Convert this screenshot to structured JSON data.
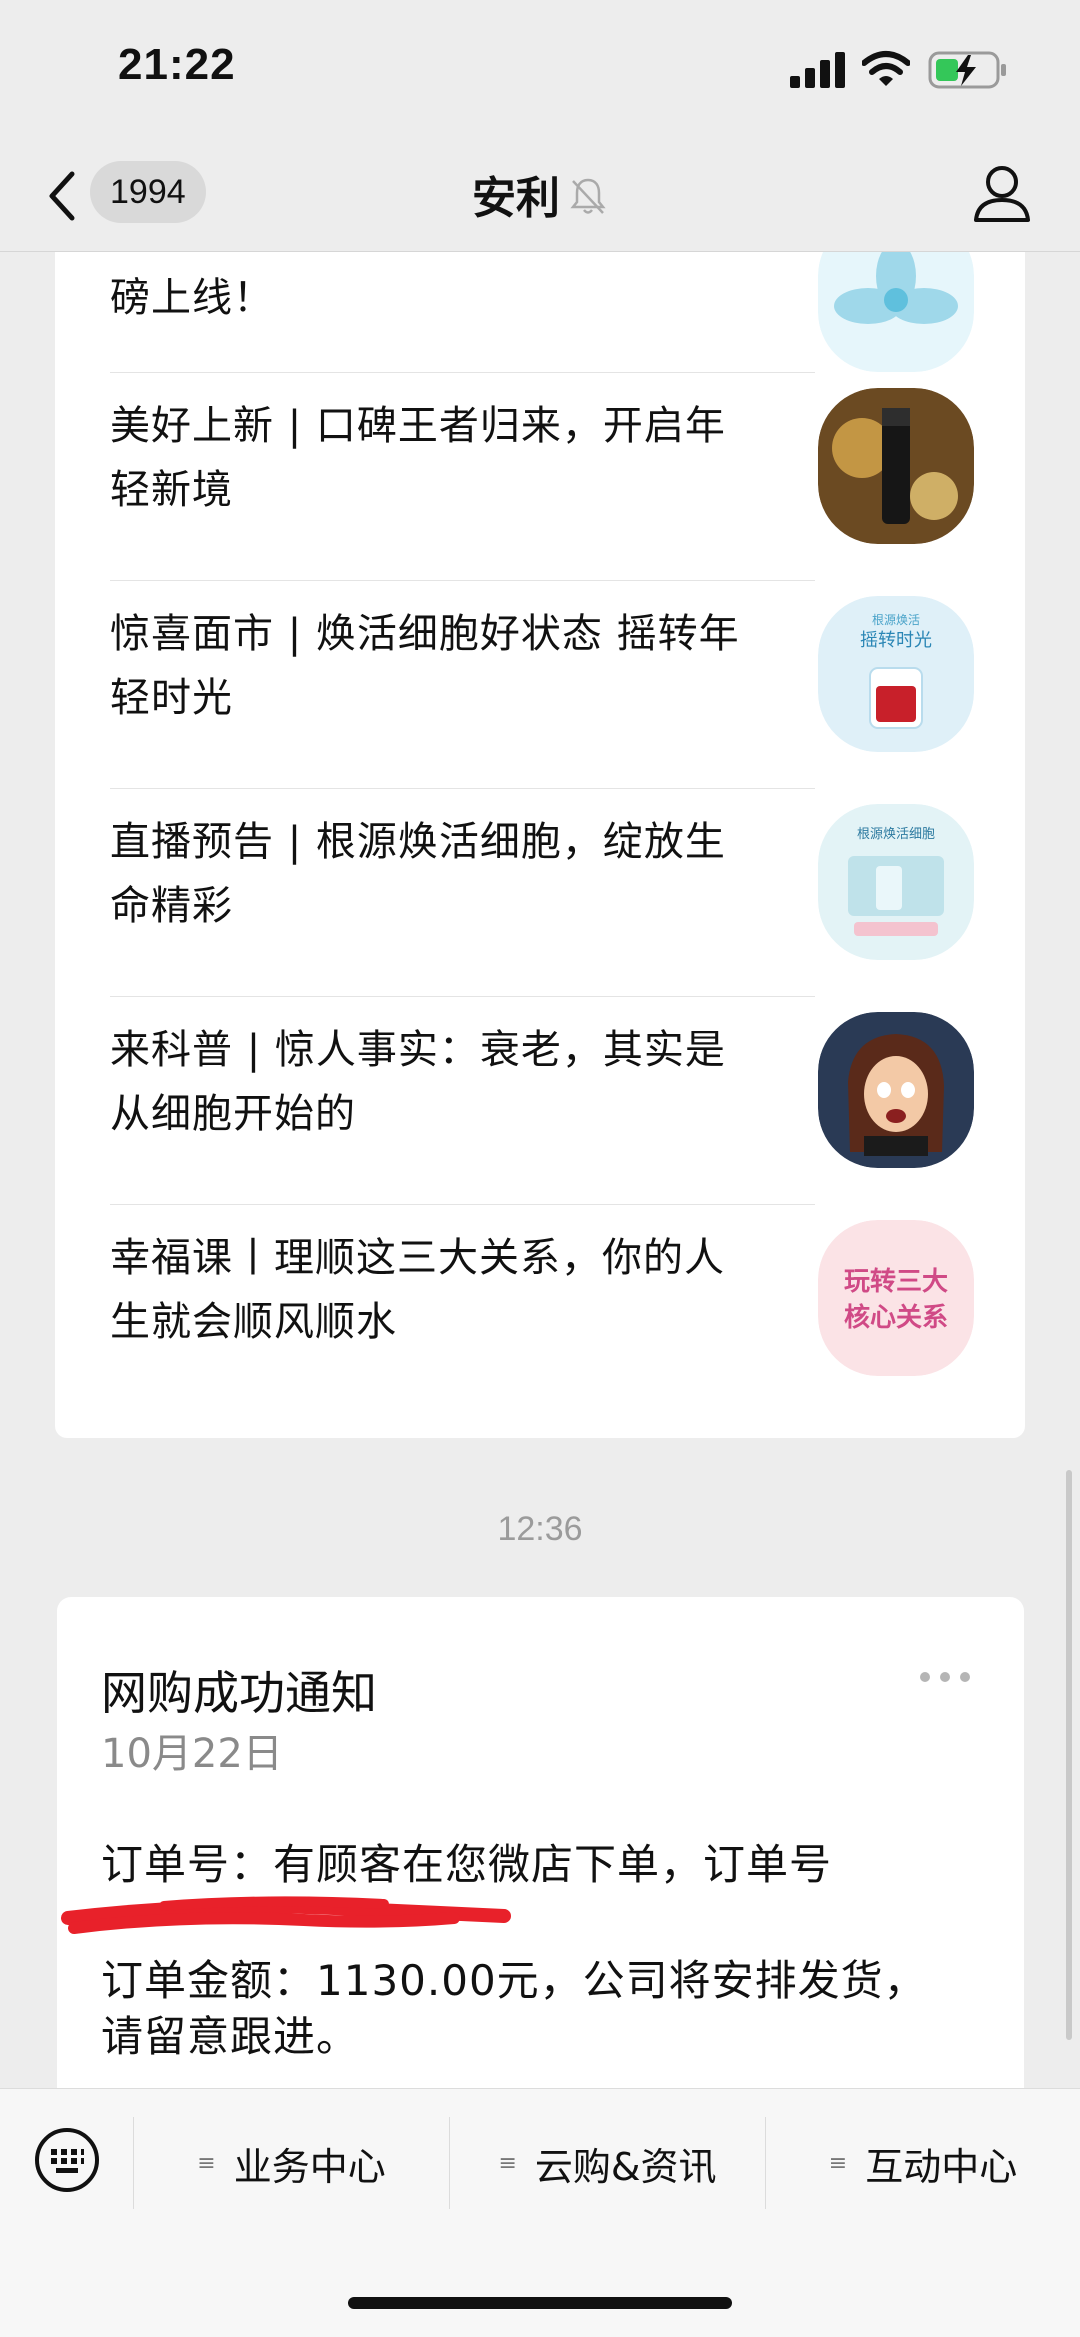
{
  "status_bar": {
    "time": "21:22",
    "icons": [
      "signal-icon",
      "wifi-icon",
      "battery-charging-icon"
    ]
  },
  "nav": {
    "unread_count": "1994",
    "title": "安利",
    "icons": [
      "back-icon",
      "mute-icon",
      "profile-icon"
    ]
  },
  "articles": [
    {
      "title": "磅上线！"
    },
    {
      "title": "美好上新 | 口碑王者归来，开启年轻新境"
    },
    {
      "title": "惊喜面市 | 焕活细胞好状态 摇转年轻时光"
    },
    {
      "title": "直播预告 | 根源焕活细胞，绽放生命精彩"
    },
    {
      "title": "来科普 | 惊人事实：衰老，其实是从细胞开始的"
    },
    {
      "title": "幸福课丨理顺这三大关系，你的人生就会顺风顺水"
    }
  ],
  "thumbnails": {
    "thumb3_text_line1": "根源焕活",
    "thumb3_text_line2": "摇转时光",
    "thumb4_text": "根源焕活细胞",
    "thumb6_line1": "玩转三大",
    "thumb6_line2": "核心关系"
  },
  "timestamp": "12:36",
  "notification": {
    "title": "网购成功通知",
    "date": "10月22日",
    "line1": "订单号：有顾客在您微店下单，订单号",
    "line2": "订单金额：1130.00元，公司将安排发货，",
    "line3": "请留意跟进。"
  },
  "bottom_menu": {
    "items": [
      "业务中心",
      "云购&资讯",
      "互动中心"
    ],
    "glyph": "≡"
  },
  "colors": {
    "background": "#ededed",
    "card": "#ffffff",
    "redaction": "#e8212a"
  }
}
